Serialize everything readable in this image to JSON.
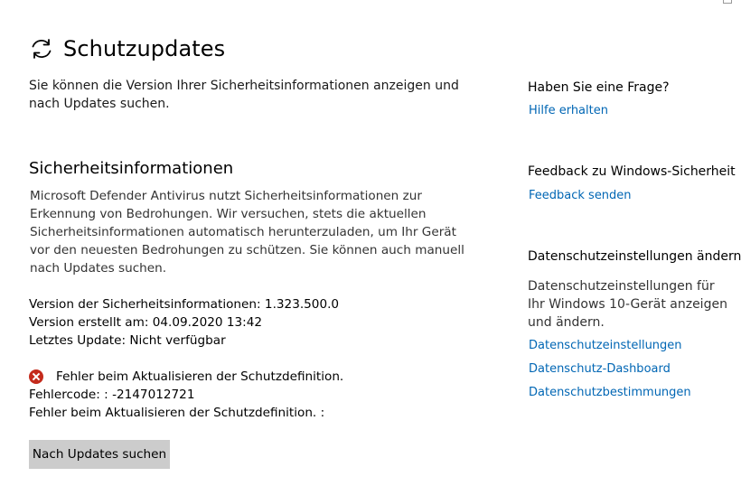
{
  "page": {
    "title": "Schutzupdates",
    "title_icon": "refresh-icon",
    "intro": "Sie können die Version Ihrer Sicherheitsinformationen anzeigen und nach Updates suchen."
  },
  "security_info": {
    "heading": "Sicherheitsinformationen",
    "description": "Microsoft Defender Antivirus nutzt Sicherheitsinformationen zur Erkennung von Bedrohungen. Wir versuchen, stets die aktuellen Sicherheitsinformationen automatisch herunterzuladen, um Ihr Gerät vor den neuesten Bedrohungen zu schützen. Sie können auch manuell nach Updates suchen.",
    "version_line": "Version der Sicherheitsinformationen: 1.323.500.0",
    "created_line": "Version erstellt am: 04.09.2020 13:42",
    "last_update_line": "Letztes Update: Nicht verfügbar"
  },
  "error": {
    "icon": "error-icon",
    "color": "#c42b1c",
    "message": "Fehler beim Aktualisieren der Schutzdefinition.",
    "code_line": "Fehlercode: : -2147012721",
    "detail_line": "Fehler beim Aktualisieren der Schutzdefinition. :"
  },
  "actions": {
    "check_updates_label": "Nach Updates suchen"
  },
  "sidebar": {
    "question_heading": "Haben Sie eine Frage?",
    "help_link": "Hilfe erhalten",
    "feedback_heading": "Feedback zu Windows-Sicherheit",
    "feedback_link": "Feedback senden",
    "privacy_heading": "Datenschutzeinstellungen ändern",
    "privacy_text": "Datenschutzeinstellungen für Ihr Windows 10-Gerät anzeigen und ändern.",
    "privacy_links": [
      "Datenschutzeinstellungen",
      "Datenschutz-Dashboard",
      "Datenschutzbestimmungen"
    ]
  },
  "colors": {
    "link": "#0066b4",
    "button_bg": "#cccccc"
  }
}
